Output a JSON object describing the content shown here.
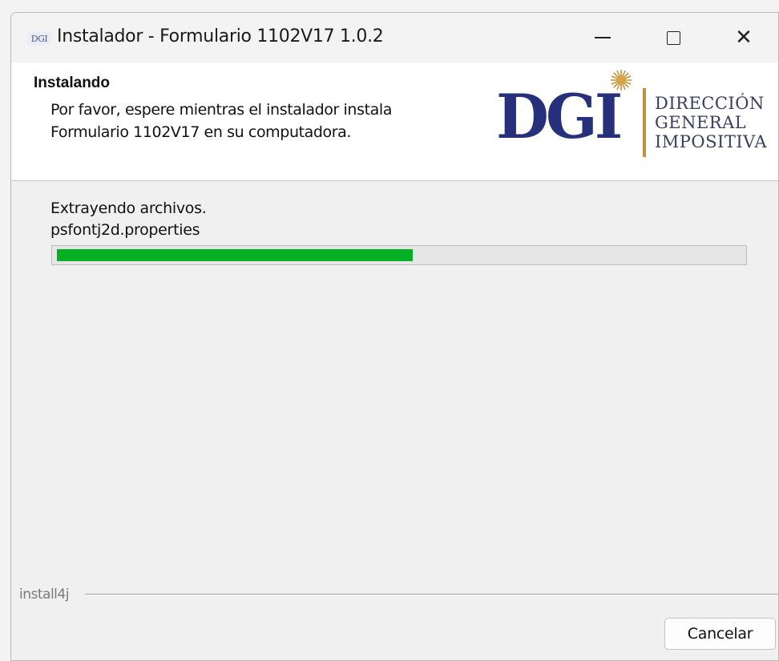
{
  "window": {
    "icon_text": "DGI",
    "title": "Instalador - Formulario 1102V17 1.0.2"
  },
  "header": {
    "title": "Instalando",
    "description_line1": "Por favor, espere mientras el instalador instala",
    "description_line2": "Formulario 1102V17 en su computadora.",
    "logo": {
      "mark": "DGI",
      "line1": "DIRECCIÓN",
      "line2": "GENERAL",
      "line3": "IMPOSITIVA"
    }
  },
  "content": {
    "status_line1": "Extrayendo archivos.",
    "status_line2": "psfontj2d.properties",
    "progress_fraction": 0.52
  },
  "footer": {
    "brand": "install4j",
    "cancel_label": "Cancelar"
  },
  "colors": {
    "progress_fill": "#06b025",
    "logo_blue": "#27307a",
    "logo_gold": "#c2903c"
  },
  "icons": [
    "dgi-app-icon",
    "minimize-icon",
    "maximize-icon",
    "close-icon",
    "sun-icon"
  ]
}
